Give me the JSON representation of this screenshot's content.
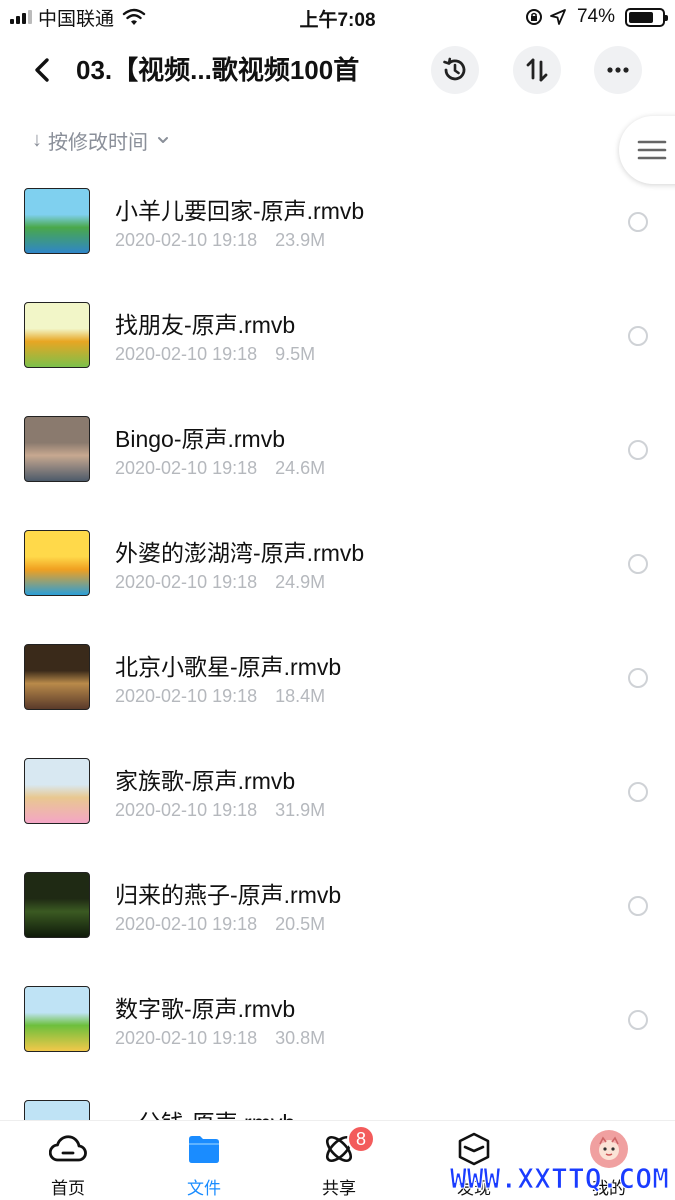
{
  "status_bar": {
    "carrier": "中国联通",
    "time": "上午7:08",
    "battery": "74%",
    "battery_level": 0.74
  },
  "nav": {
    "title": "03.【视频...歌视频100首",
    "back_icon": "chevron-left-icon",
    "history_icon": "history-icon",
    "sort_icon": "sort-arrows-icon",
    "more_icon": "more-dots-icon"
  },
  "sort": {
    "label": "按修改时间",
    "arrow": "↓"
  },
  "files": [
    {
      "name": "小羊儿要回家-原声.rmvb",
      "date": "2020-02-10 19:18",
      "size": "23.9M",
      "thumb_colors": [
        "#7fd0ef",
        "#4aa84a",
        "#2f86c8"
      ]
    },
    {
      "name": "找朋友-原声.rmvb",
      "date": "2020-02-10 19:18",
      "size": "9.5M",
      "thumb_colors": [
        "#f2f6c8",
        "#e8a623",
        "#7cc04b"
      ]
    },
    {
      "name": "Bingo-原声.rmvb",
      "date": "2020-02-10 19:18",
      "size": "24.6M",
      "thumb_colors": [
        "#8a7a6e",
        "#c7a890",
        "#4d5a6a"
      ]
    },
    {
      "name": "外婆的澎湖湾-原声.rmvb",
      "date": "2020-02-10 19:18",
      "size": "24.9M",
      "thumb_colors": [
        "#ffd94a",
        "#f0a020",
        "#2b9fd8"
      ]
    },
    {
      "name": "北京小歌星-原声.rmvb",
      "date": "2020-02-10 19:18",
      "size": "18.4M",
      "thumb_colors": [
        "#3a2a1a",
        "#b98a4a",
        "#5a3a2a"
      ]
    },
    {
      "name": "家族歌-原声.rmvb",
      "date": "2020-02-10 19:18",
      "size": "31.9M",
      "thumb_colors": [
        "#d8e8f2",
        "#e8c890",
        "#f4a6c6"
      ]
    },
    {
      "name": "归来的燕子-原声.rmvb",
      "date": "2020-02-10 19:18",
      "size": "20.5M",
      "thumb_colors": [
        "#1f2a14",
        "#3b5a22",
        "#0f1a0a"
      ]
    },
    {
      "name": "数字歌-原声.rmvb",
      "date": "2020-02-10 19:18",
      "size": "30.8M",
      "thumb_colors": [
        "#bfe3f5",
        "#6cbf3c",
        "#f2c84a"
      ]
    },
    {
      "name": "一分钱-原声.rmvb",
      "date": "",
      "size": "",
      "thumb_colors": [
        "#bfe3f5",
        "#9fd06a",
        "#ffe08a"
      ]
    }
  ],
  "tabs": [
    {
      "label": "首页",
      "icon": "cloud-icon",
      "active": false
    },
    {
      "label": "文件",
      "icon": "folder-icon",
      "active": true
    },
    {
      "label": "共享",
      "icon": "orbit-icon",
      "active": false,
      "badge": "8"
    },
    {
      "label": "发现",
      "icon": "box-icon",
      "active": false
    },
    {
      "label": "我的",
      "icon": "avatar-icon",
      "active": false
    }
  ],
  "watermark": "WWW.XXTTQ.COM",
  "colors": {
    "accent": "#1a8cff",
    "badge": "#f35b5b",
    "meta_text": "#b5b8bd",
    "sort_text": "#8a8f99"
  }
}
